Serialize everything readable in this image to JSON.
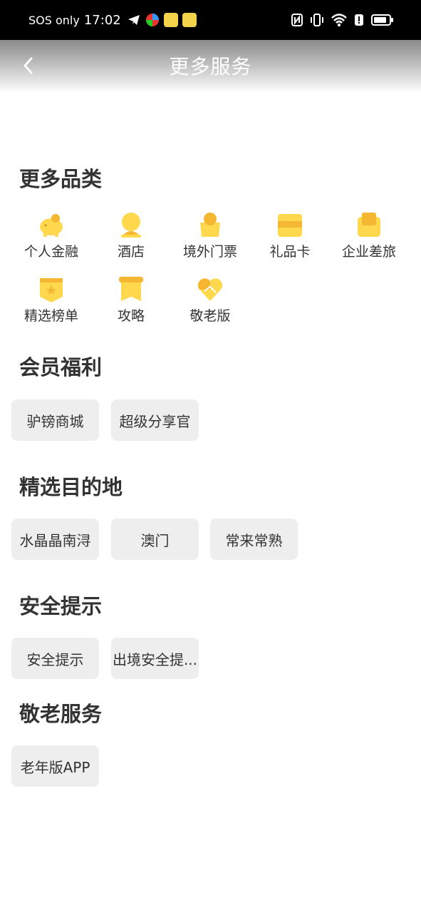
{
  "status_bar": {
    "carrier": "SOS only",
    "time": "17:02",
    "icons": [
      "telegram-icon",
      "app-icon-1",
      "app-icon-2",
      "app-icon-3",
      "nfc-icon",
      "vibrate-icon",
      "wifi-icon",
      "alert-icon",
      "battery-icon"
    ]
  },
  "nav": {
    "title": "更多服务",
    "back_icon": "chevron-left-icon"
  },
  "sections": {
    "categories": {
      "title": "更多品类",
      "items": [
        {
          "label": "个人金融",
          "icon": "piggy-bank-icon"
        },
        {
          "label": "酒店",
          "icon": "hotel-icon"
        },
        {
          "label": "境外门票",
          "icon": "ticket-bag-icon"
        },
        {
          "label": "礼品卡",
          "icon": "gift-card-icon"
        },
        {
          "label": "企业差旅",
          "icon": "luggage-icon"
        },
        {
          "label": "精选榜单",
          "icon": "ranking-icon"
        },
        {
          "label": "攻略",
          "icon": "guide-icon"
        },
        {
          "label": "敬老版",
          "icon": "heart-hands-icon"
        }
      ]
    },
    "member": {
      "title": "会员福利",
      "chips": [
        "驴镑商城",
        "超级分享官"
      ]
    },
    "destinations": {
      "title": "精选目的地",
      "chips": [
        "水晶晶南浔",
        "澳门",
        "常来常熟"
      ]
    },
    "safety": {
      "title": "安全提示",
      "chips": [
        "安全提示",
        "出境安全提..."
      ]
    },
    "elder": {
      "title": "敬老服务",
      "chips": [
        "老年版APP"
      ]
    }
  },
  "colors": {
    "icon_yellow": "#FFD84D",
    "icon_orange": "#F5B731",
    "chip_bg": "#EEEEEE"
  }
}
